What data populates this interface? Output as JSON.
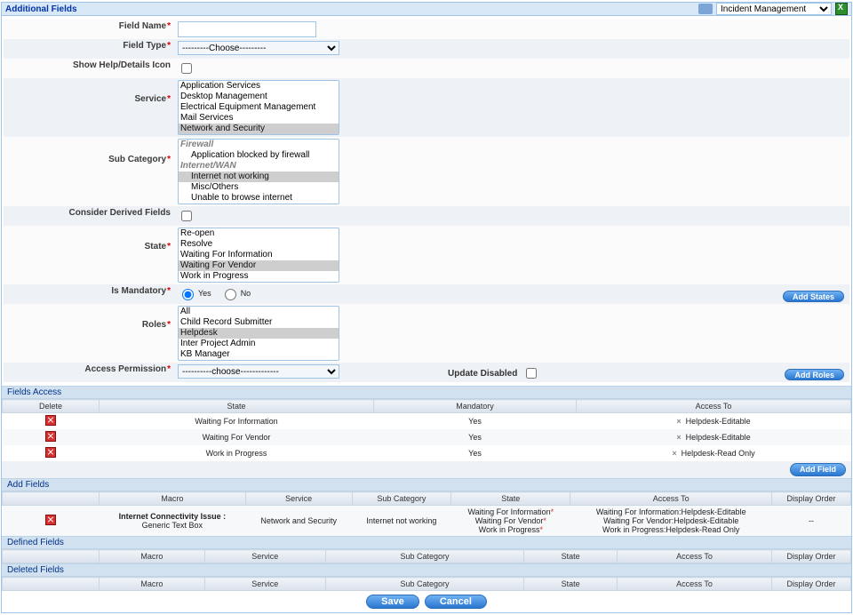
{
  "header": {
    "title": "Additional Fields",
    "module_select": "Incident Management"
  },
  "form": {
    "field_name_label": "Field Name",
    "field_name_value": "",
    "field_type_label": "Field Type",
    "field_type_value": "---------Choose---------",
    "show_help_label": "Show Help/Details Icon",
    "service_label": "Service",
    "service_options": [
      "Application Services",
      "Desktop Management",
      "Electrical Equipment Management",
      "Mail Services",
      "Network and Security"
    ],
    "service_selected": "Network and Security",
    "subcat_label": "Sub Category",
    "subcat_groups": [
      {
        "group": "Firewall",
        "items": [
          "Application blocked by firewall"
        ]
      },
      {
        "group": "Internet/WAN",
        "items": [
          "Internet not working",
          "Misc/Others",
          "Unable to browse internet"
        ]
      }
    ],
    "subcat_selected": "Internet not working",
    "consider_derived_label": "Consider Derived Fields",
    "state_label": "State",
    "state_options": [
      "Re-open",
      "Resolve",
      "Waiting For Information",
      "Waiting For Vendor",
      "Work in Progress"
    ],
    "state_selected": "Waiting For Vendor",
    "mandatory_label": "Is Mandatory",
    "mandatory_yes": "Yes",
    "mandatory_no": "No",
    "roles_label": "Roles",
    "roles_options": [
      "All",
      "Child Record Submitter",
      "Helpdesk",
      "Inter Project Admin",
      "KB Manager"
    ],
    "roles_selected": "Helpdesk",
    "access_perm_label": "Access Permission",
    "access_perm_value": "----------choose-------------",
    "update_disabled_label": "Update Disabled",
    "btn_add_states": "Add States",
    "btn_add_roles": "Add Roles",
    "btn_add_field": "Add Field"
  },
  "fields_access": {
    "sect_title": "Fields Access",
    "cols": {
      "delete": "Delete",
      "state": "State",
      "mandatory": "Mandatory",
      "access": "Access To"
    },
    "rows": [
      {
        "state": "Waiting For Information",
        "mandatory": "Yes",
        "access": "Helpdesk-Editable"
      },
      {
        "state": "Waiting For Vendor",
        "mandatory": "Yes",
        "access": "Helpdesk-Editable"
      },
      {
        "state": "Work in Progress",
        "mandatory": "Yes",
        "access": "Helpdesk-Read Only"
      }
    ]
  },
  "add_fields": {
    "sect_title": "Add Fields",
    "cols": {
      "macro": "Macro",
      "service": "Service",
      "subcat": "Sub Category",
      "state": "State",
      "access": "Access To",
      "order": "Display Order"
    },
    "row": {
      "macro_title": "Internet Connectivity Issue :",
      "macro_sub": "Generic Text Box",
      "service": "Network and Security",
      "subcat": "Internet not working",
      "state_lines": [
        "Waiting For Information*",
        "Waiting For Vendor*",
        "Work in Progress*"
      ],
      "access_lines": [
        "Waiting For Information:Helpdesk-Editable",
        "Waiting For Vendor:Helpdesk-Editable",
        "Work in Progress:Helpdesk-Read Only"
      ],
      "order": "--"
    }
  },
  "defined_fields": {
    "sect_title": "Defined Fields",
    "cols": {
      "macro": "Macro",
      "service": "Service",
      "subcat": "Sub Category",
      "state": "State",
      "access": "Access To",
      "order": "Display Order"
    }
  },
  "deleted_fields": {
    "sect_title": "Deleted Fields",
    "cols": {
      "macro": "Macro",
      "service": "Service",
      "subcat": "Sub Category",
      "state": "State",
      "access": "Access To",
      "order": "Display Order"
    }
  },
  "footer": {
    "save": "Save",
    "cancel": "Cancel"
  }
}
